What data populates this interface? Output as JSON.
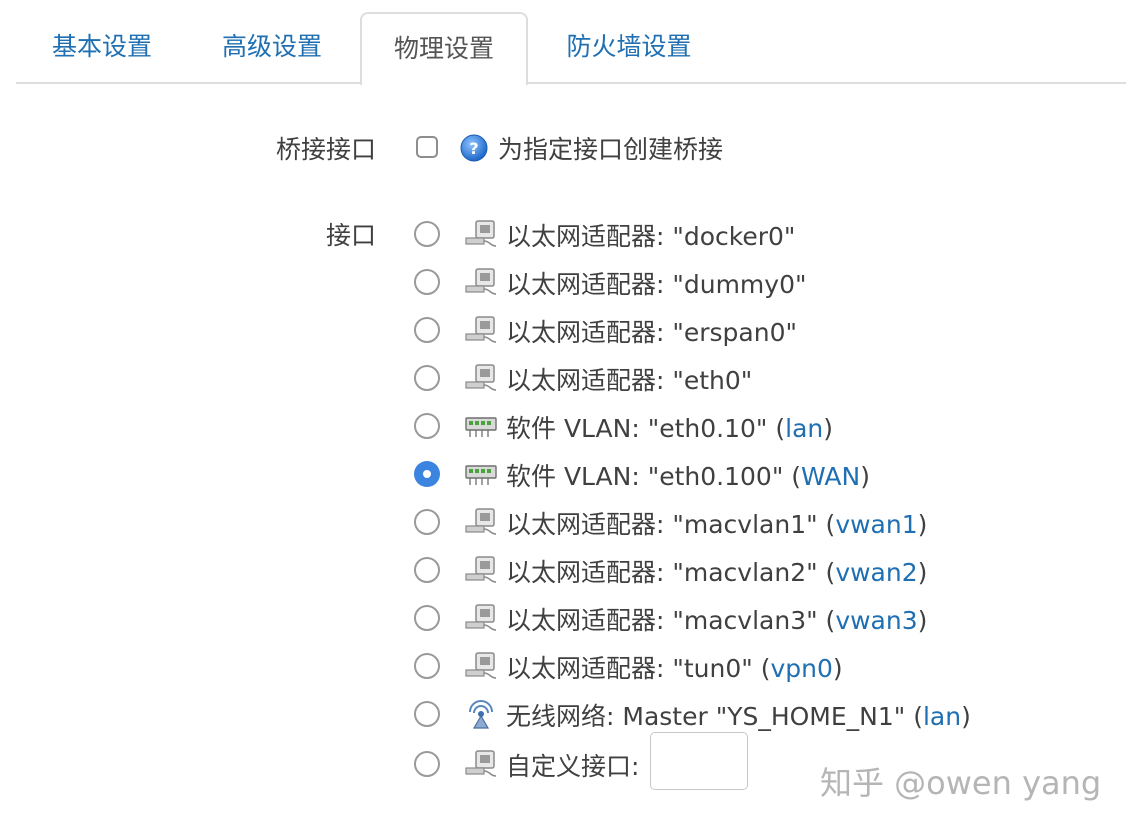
{
  "tabs": [
    {
      "label": "基本设置",
      "active": false
    },
    {
      "label": "高级设置",
      "active": false
    },
    {
      "label": "物理设置",
      "active": true
    },
    {
      "label": "防火墙设置",
      "active": false
    }
  ],
  "bridge": {
    "label": "桥接接口",
    "checked": false,
    "help_text": "为指定接口创建桥接",
    "help_icon": "help-icon"
  },
  "interfaces_label": "接口",
  "interfaces": [
    {
      "type": "ethernet",
      "text": "以太网适配器: \"docker0\"",
      "network": "",
      "selected": false
    },
    {
      "type": "ethernet",
      "text": "以太网适配器: \"dummy0\"",
      "network": "",
      "selected": false
    },
    {
      "type": "ethernet",
      "text": "以太网适配器: \"erspan0\"",
      "network": "",
      "selected": false
    },
    {
      "type": "ethernet",
      "text": "以太网适配器: \"eth0\"",
      "network": "",
      "selected": false
    },
    {
      "type": "vlan",
      "text": "软件 VLAN: \"eth0.10\"",
      "network": "lan",
      "selected": false
    },
    {
      "type": "vlan",
      "text": "软件 VLAN: \"eth0.100\"",
      "network": "WAN",
      "selected": true
    },
    {
      "type": "ethernet",
      "text": "以太网适配器: \"macvlan1\"",
      "network": "vwan1",
      "selected": false
    },
    {
      "type": "ethernet",
      "text": "以太网适配器: \"macvlan2\"",
      "network": "vwan2",
      "selected": false
    },
    {
      "type": "ethernet",
      "text": "以太网适配器: \"macvlan3\"",
      "network": "vwan3",
      "selected": false
    },
    {
      "type": "ethernet",
      "text": "以太网适配器: \"tun0\"",
      "network": "vpn0",
      "selected": false
    },
    {
      "type": "wifi",
      "text": "无线网络: Master \"YS_HOME_N1\"",
      "network": "lan",
      "selected": false
    },
    {
      "type": "ethernet",
      "text": "自定义接口:",
      "network": "",
      "selected": false
    }
  ],
  "custom_input_value": "",
  "watermark": "知乎 @owen yang",
  "colors": {
    "link": "#1f6fb2",
    "radio_checked": "#3b84e0",
    "text": "#404040"
  }
}
